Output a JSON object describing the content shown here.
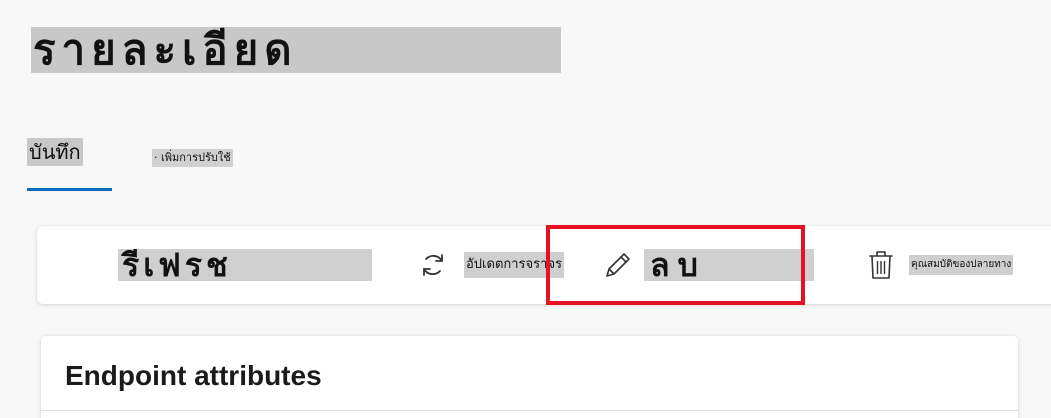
{
  "page": {
    "title": "รายละเอียด"
  },
  "tabs": [
    {
      "label": "บันทึก",
      "active": true
    },
    {
      "label": "· เพิ่มการปรับใช้",
      "active": false
    }
  ],
  "toolbar": {
    "refresh_label": "รีเฟรช",
    "update_label": "อัปเดตการจราจร",
    "delete_label": "ลบ",
    "remove_label": "คุณสมบัติของปลายทาง"
  },
  "panel": {
    "title": "Endpoint attributes"
  },
  "icons": {
    "update": "refresh-arrows-icon",
    "delete": "pencil-icon",
    "remove": "trash-icon"
  },
  "colors": {
    "accent": "#0f6cbd",
    "highlight": "#e81123"
  }
}
